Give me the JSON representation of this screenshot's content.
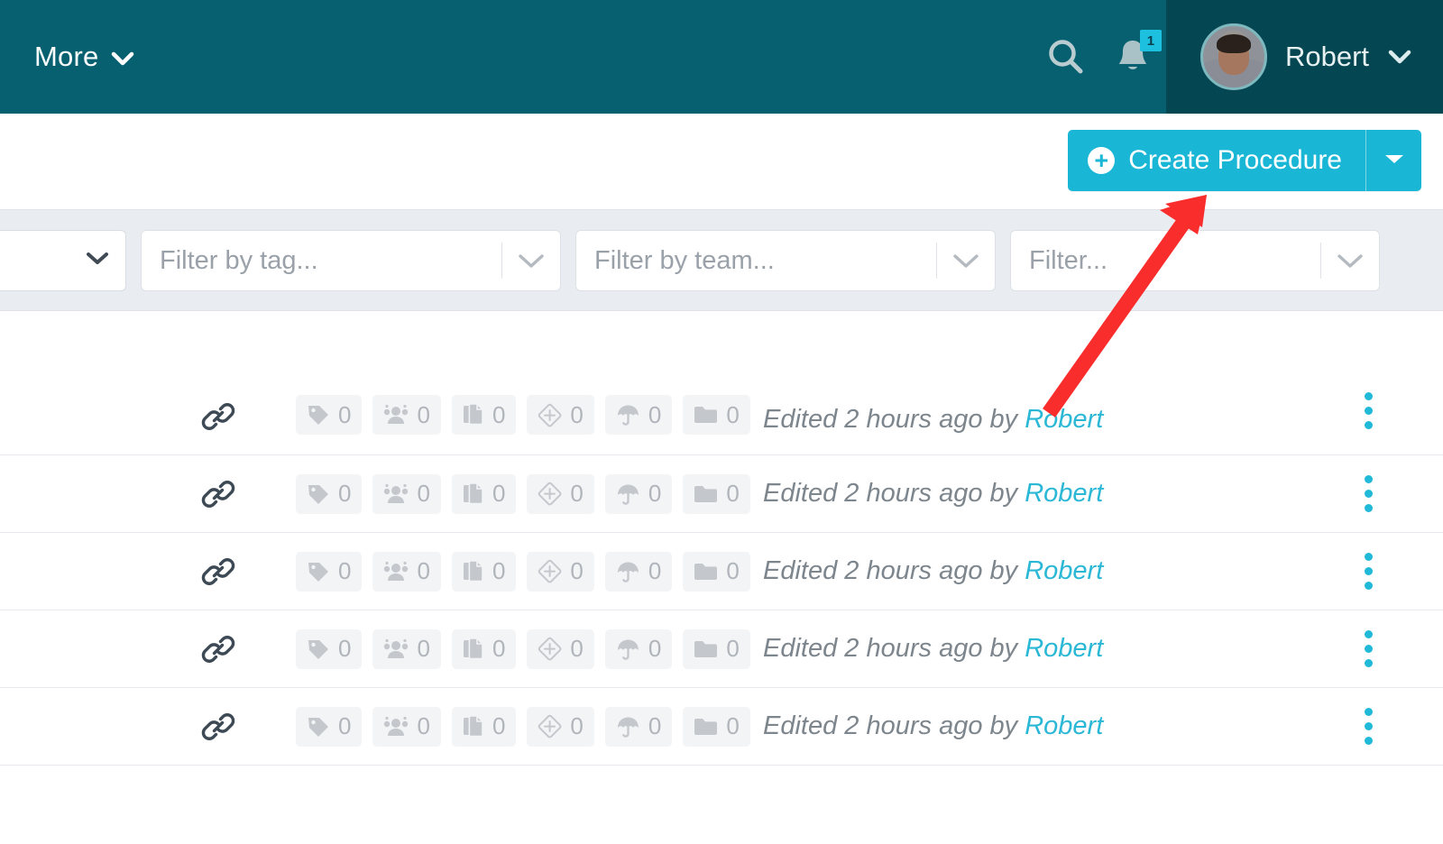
{
  "header": {
    "nav_more_label": "More",
    "search_icon": "search-icon",
    "bell_icon": "bell-icon",
    "notification_count": "1",
    "user_name": "Robert",
    "avatar_icon": "user-avatar",
    "chevron_icon": "chevron-down-icon"
  },
  "action_bar": {
    "create_button_label": "Create Procedure",
    "create_button_icon": "plus-circle-icon",
    "create_button_caret_icon": "caret-down-icon",
    "accent_color": "#1ab6d6"
  },
  "filters": {
    "status_select": {
      "name": "status-select",
      "value": "",
      "chevron_icon": "chevron-down-icon"
    },
    "tag_filter": {
      "placeholder": "Filter by tag...",
      "value": "",
      "chevron_icon": "chevron-down-icon"
    },
    "team_filter": {
      "placeholder": "Filter by team...",
      "value": "",
      "chevron_icon": "chevron-down-icon"
    },
    "misc_filter": {
      "placeholder": "Filter...",
      "value": "",
      "chevron_icon": "chevron-down-icon"
    }
  },
  "list": {
    "chip_icons": [
      "tag-icon",
      "users-icon",
      "copy-documents-icon",
      "diamond-icon",
      "umbrella-icon",
      "folder-icon"
    ],
    "link_icon": "link-icon",
    "kebab_icon": "vertical-dots-icon",
    "rows": [
      {
        "chips": [
          {
            "icon": "tag-icon",
            "count": "0"
          },
          {
            "icon": "users-icon",
            "count": "0"
          },
          {
            "icon": "copy-documents-icon",
            "count": "0"
          },
          {
            "icon": "diamond-icon",
            "count": "0"
          },
          {
            "icon": "umbrella-icon",
            "count": "0"
          },
          {
            "icon": "folder-icon",
            "count": "0"
          }
        ],
        "edited_prefix": "Edited 2 hours ago by ",
        "author": "Robert"
      },
      {
        "chips": [
          {
            "icon": "tag-icon",
            "count": "0"
          },
          {
            "icon": "users-icon",
            "count": "0"
          },
          {
            "icon": "copy-documents-icon",
            "count": "0"
          },
          {
            "icon": "diamond-icon",
            "count": "0"
          },
          {
            "icon": "umbrella-icon",
            "count": "0"
          },
          {
            "icon": "folder-icon",
            "count": "0"
          }
        ],
        "edited_prefix": "Edited 2 hours ago by ",
        "author": "Robert"
      },
      {
        "chips": [
          {
            "icon": "tag-icon",
            "count": "0"
          },
          {
            "icon": "users-icon",
            "count": "0"
          },
          {
            "icon": "copy-documents-icon",
            "count": "0"
          },
          {
            "icon": "diamond-icon",
            "count": "0"
          },
          {
            "icon": "umbrella-icon",
            "count": "0"
          },
          {
            "icon": "folder-icon",
            "count": "0"
          }
        ],
        "edited_prefix": "Edited 2 hours ago by ",
        "author": "Robert"
      },
      {
        "chips": [
          {
            "icon": "tag-icon",
            "count": "0"
          },
          {
            "icon": "users-icon",
            "count": "0"
          },
          {
            "icon": "copy-documents-icon",
            "count": "0"
          },
          {
            "icon": "diamond-icon",
            "count": "0"
          },
          {
            "icon": "umbrella-icon",
            "count": "0"
          },
          {
            "icon": "folder-icon",
            "count": "0"
          }
        ],
        "edited_prefix": "Edited 2 hours ago by ",
        "author": "Robert"
      },
      {
        "chips": [
          {
            "icon": "tag-icon",
            "count": "0"
          },
          {
            "icon": "users-icon",
            "count": "0"
          },
          {
            "icon": "copy-documents-icon",
            "count": "0"
          },
          {
            "icon": "diamond-icon",
            "count": "0"
          },
          {
            "icon": "umbrella-icon",
            "count": "0"
          },
          {
            "icon": "folder-icon",
            "count": "0"
          }
        ],
        "edited_prefix": "Edited 2 hours ago by ",
        "author": "Robert"
      }
    ]
  },
  "annotation": {
    "type": "arrow",
    "color": "#fa2d2d",
    "points_to": "create-procedure-button"
  },
  "theme": {
    "header_bg": "#076070",
    "header_user_bg": "#044651",
    "accent": "#1ab6d6",
    "filter_bar_bg": "#e9ecf0"
  }
}
